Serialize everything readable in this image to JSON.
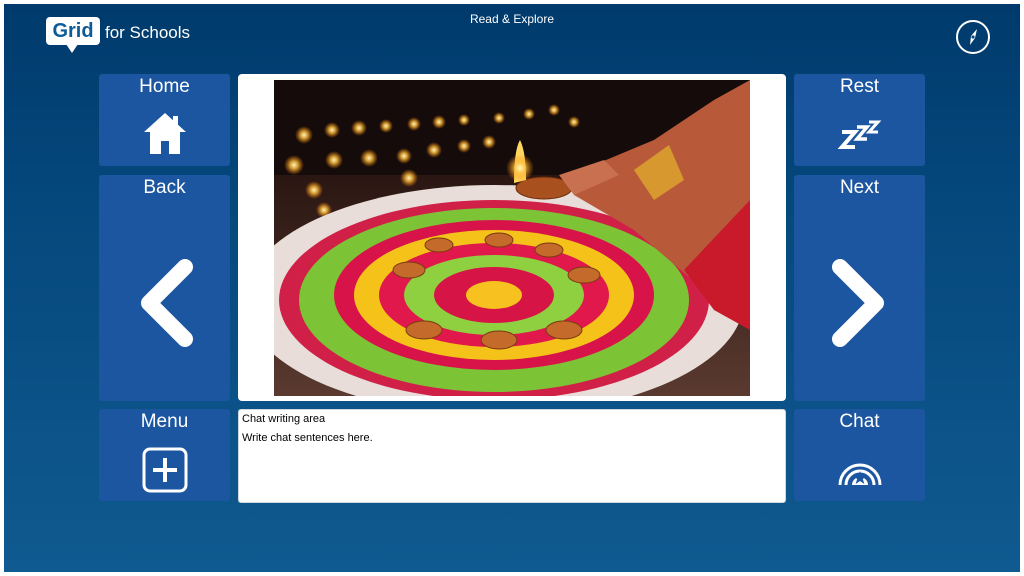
{
  "header": {
    "logo_badge": "Grid",
    "logo_text": "for Schools",
    "title": "Read & Explore",
    "compass_icon": "compass-icon"
  },
  "cells": {
    "home": "Home",
    "rest": "Rest",
    "back": "Back",
    "next": "Next",
    "menu": "Menu",
    "chat": "Chat"
  },
  "image": {
    "subject": "Diwali rangoli with lit diyas"
  },
  "chat_area": {
    "title": "Chat writing area",
    "placeholder": "Write chat sentences here."
  },
  "colors": {
    "background_top": "#003a6c",
    "background_bottom": "#0f5a90",
    "cell": "#1c56a0",
    "text": "#ffffff"
  }
}
